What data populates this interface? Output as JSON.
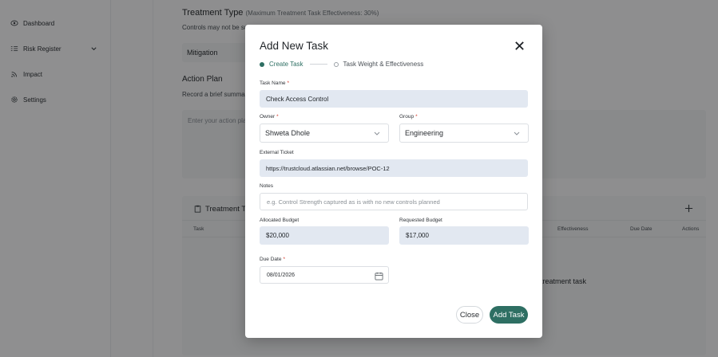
{
  "sidebar": {
    "items": [
      {
        "label": "Dashboard",
        "icon": "eye-icon"
      },
      {
        "label": "Risk Register",
        "icon": "list-icon"
      },
      {
        "label": "Impact",
        "icon": "rss-icon"
      },
      {
        "label": "Settings",
        "icon": "gear-icon"
      }
    ]
  },
  "background": {
    "treatment_type_title": "Treatment Type",
    "treatment_type_sub": "(Maximum Treatment Task Effectiveness: 30%)",
    "controls_text": "Controls may not be su",
    "mitigation_value": "Mitigation",
    "action_plan_title": "Action Plan",
    "action_plan_text": "Record a brief summar",
    "action_plan_placeholder": "Enter your action pla",
    "treatment_tasks_title": "Treatment Ta",
    "columns": [
      "Task",
      "Effectiveness",
      "Due Date",
      "Actions"
    ],
    "empty_text": "v treatment task"
  },
  "modal": {
    "title": "Add New Task",
    "steps": [
      "Create Task",
      "Task Weight & Effectiveness"
    ],
    "task_name_label": "Task Name",
    "task_name_value": "Check Access Control",
    "owner_label": "Owner",
    "owner_value": "Shweta Dhole",
    "group_label": "Group",
    "group_value": "Engineering",
    "external_ticket_label": "External Ticket",
    "external_ticket_value": "https://trustcloud.atlassian.net/browse/POC-12",
    "notes_label": "Notes",
    "notes_placeholder": "e.g. Control Strength captured as is with no new controls planned",
    "allocated_budget_label": "Allocated Budget",
    "allocated_budget_value": "$20,000",
    "requested_budget_label": "Requested Budget",
    "requested_budget_value": "$17,000",
    "due_date_label": "Due Date",
    "due_date_value": "08/01/2026",
    "close_label": "Close",
    "add_task_label": "Add Task",
    "required_mark": "*"
  },
  "colors": {
    "accent": "#2e6f63",
    "required": "#d33a2c",
    "field_fill": "#e2e8f1"
  }
}
